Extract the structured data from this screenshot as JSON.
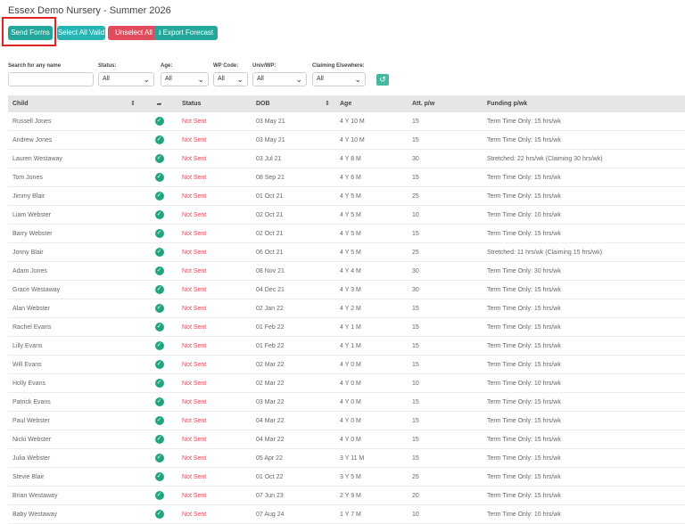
{
  "page": {
    "title": "Essex Demo Nursery - Summer 2026"
  },
  "toolbar": {
    "send_forms": "Send Forms",
    "select_all_valid": "Select All Valid",
    "unselect_all": "Unselect All",
    "export_forecast": "Export Forecast"
  },
  "filters": {
    "search_label": "Search for any name",
    "search_value": "",
    "status_label": "Status:",
    "status_value": "All",
    "age_label": "Age:",
    "age_value": "All",
    "wp_code_label": "WP Code:",
    "wp_code_value": "All",
    "univ_wp_label": "Univ/WP:",
    "univ_wp_value": "All",
    "claiming_label": "Claiming Elsewhere:",
    "claiming_value": "All"
  },
  "table": {
    "headers": {
      "child": "Child",
      "status": "Status",
      "dob": "DOB",
      "age": "Age",
      "att": "Att. p/w",
      "funding": "Funding p/wk"
    },
    "rows": [
      {
        "child": "Russell Jones",
        "status": "Not Sent",
        "dob": "03 May 21",
        "age": "4 Y 10 M",
        "att": "15",
        "funding": "Term Time Only: 15 hrs/wk"
      },
      {
        "child": "Andrew Jones",
        "status": "Not Sent",
        "dob": "03 May 21",
        "age": "4 Y 10 M",
        "att": "15",
        "funding": "Term Time Only: 15 hrs/wk"
      },
      {
        "child": "Lauren Westaway",
        "status": "Not Sent",
        "dob": "03 Jul 21",
        "age": "4 Y 8 M",
        "att": "30",
        "funding": "Stretched: 22 hrs/wk (Claiming 30 hrs/wk)"
      },
      {
        "child": "Tom Jones",
        "status": "Not Sent",
        "dob": "08 Sep 21",
        "age": "4 Y 6 M",
        "att": "15",
        "funding": "Term Time Only: 15 hrs/wk"
      },
      {
        "child": "Jimmy Blair",
        "status": "Not Sent",
        "dob": "01 Oct 21",
        "age": "4 Y 5 M",
        "att": "25",
        "funding": "Term Time Only: 15 hrs/wk"
      },
      {
        "child": "Liam Webster",
        "status": "Not Sent",
        "dob": "02 Oct 21",
        "age": "4 Y 5 M",
        "att": "10",
        "funding": "Term Time Only: 10 hrs/wk"
      },
      {
        "child": "Barry Webster",
        "status": "Not Sent",
        "dob": "02 Oct 21",
        "age": "4 Y 5 M",
        "att": "15",
        "funding": "Term Time Only: 15 hrs/wk"
      },
      {
        "child": "Jonny Blair",
        "status": "Not Sent",
        "dob": "06 Oct 21",
        "age": "4 Y 5 M",
        "att": "25",
        "funding": "Stretched: 11 hrs/wk (Claiming 15 hrs/wk)"
      },
      {
        "child": "Adam Jones",
        "status": "Not Sent",
        "dob": "08 Nov 21",
        "age": "4 Y 4 M",
        "att": "30",
        "funding": "Term Time Only: 30 hrs/wk"
      },
      {
        "child": "Grace Westaway",
        "status": "Not Sent",
        "dob": "04 Dec 21",
        "age": "4 Y 3 M",
        "att": "30",
        "funding": "Term Time Only: 15 hrs/wk"
      },
      {
        "child": "Alan Webster",
        "status": "Not Sent",
        "dob": "02 Jan 22",
        "age": "4 Y 2 M",
        "att": "15",
        "funding": "Term Time Only: 15 hrs/wk"
      },
      {
        "child": "Rachel Evans",
        "status": "Not Sent",
        "dob": "01 Feb 22",
        "age": "4 Y 1 M",
        "att": "15",
        "funding": "Term Time Only: 15 hrs/wk"
      },
      {
        "child": "Lilly Evans",
        "status": "Not Sent",
        "dob": "01 Feb 22",
        "age": "4 Y 1 M",
        "att": "15",
        "funding": "Term Time Only: 15 hrs/wk"
      },
      {
        "child": "Will Evans",
        "status": "Not Sent",
        "dob": "02 Mar 22",
        "age": "4 Y 0 M",
        "att": "15",
        "funding": "Term Time Only: 15 hrs/wk"
      },
      {
        "child": "Holly Evans",
        "status": "Not Sent",
        "dob": "02 Mar 22",
        "age": "4 Y 0 M",
        "att": "10",
        "funding": "Term Time Only: 10 hrs/wk"
      },
      {
        "child": "Patrick Evans",
        "status": "Not Sent",
        "dob": "03 Mar 22",
        "age": "4 Y 0 M",
        "att": "15",
        "funding": "Term Time Only: 15 hrs/wk"
      },
      {
        "child": "Paul Webster",
        "status": "Not Sent",
        "dob": "04 Mar 22",
        "age": "4 Y 0 M",
        "att": "15",
        "funding": "Term Time Only: 15 hrs/wk"
      },
      {
        "child": "Nicki Webster",
        "status": "Not Sent",
        "dob": "04 Mar 22",
        "age": "4 Y 0 M",
        "att": "15",
        "funding": "Term Time Only: 15 hrs/wk"
      },
      {
        "child": "Julia Webster",
        "status": "Not Sent",
        "dob": "05 Apr 22",
        "age": "3 Y 11 M",
        "att": "15",
        "funding": "Term Time Only: 15 hrs/wk"
      },
      {
        "child": "Stevie Blair",
        "status": "Not Sent",
        "dob": "01 Oct 22",
        "age": "3 Y 5 M",
        "att": "25",
        "funding": "Term Time Only: 15 hrs/wk"
      },
      {
        "child": "Brian Westaway",
        "status": "Not Sent",
        "dob": "07 Jun 23",
        "age": "2 Y 9 M",
        "att": "20",
        "funding": "Term Time Only: 15 hrs/wk"
      },
      {
        "child": "Baby Westaway",
        "status": "Not Sent",
        "dob": "07 Aug 24",
        "age": "1 Y 7 M",
        "att": "10",
        "funding": "Term Time Only: 10 hrs/wk"
      }
    ]
  }
}
